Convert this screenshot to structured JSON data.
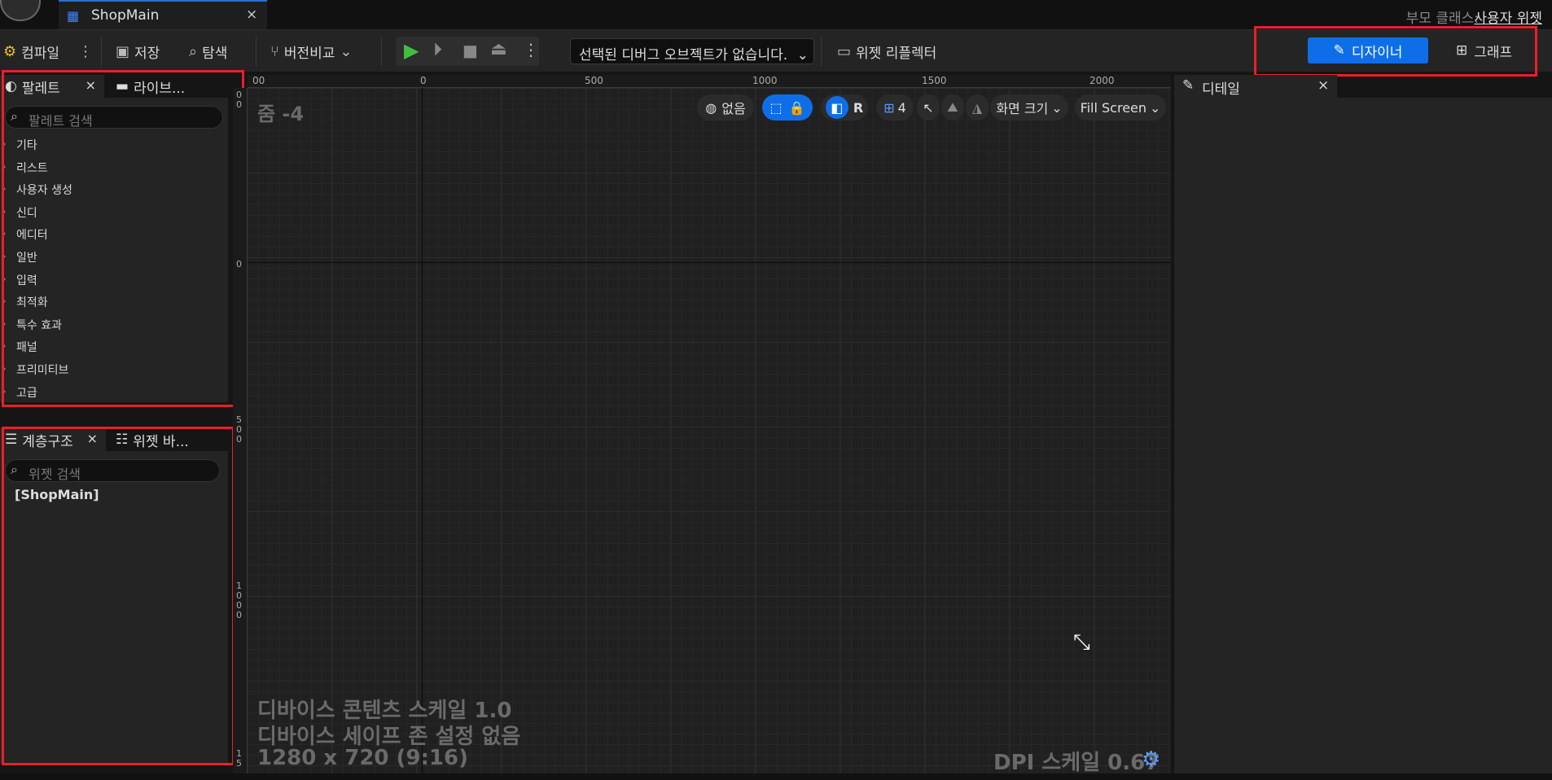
{
  "titlebar": {
    "document_tab": "ShopMain",
    "close_glyph": "×",
    "parent_class_label": "부모 클래스:",
    "parent_class_value": "사용자 위젯"
  },
  "toolbar": {
    "compile": "컴파일",
    "save": "저장",
    "browse": "탐색",
    "diff": "버전비교",
    "debug_object": "선택된 디버그 오브젝트가 없습니다.",
    "widget_reflector": "위젯 리플렉터",
    "designer": "디자이너",
    "graph": "그래프"
  },
  "palette": {
    "tab_label": "팔레트",
    "library_tab": "라이브...",
    "search_placeholder": "팔레트 검색",
    "categories": [
      "기타",
      "리스트",
      "사용자 생성",
      "신디",
      "에디터",
      "일반",
      "입력",
      "최적화",
      "특수 효과",
      "패널",
      "프리미티브",
      "고급"
    ]
  },
  "hierarchy": {
    "tab_label": "계층구조",
    "widget_binding_tab": "위젯 바...",
    "search_placeholder": "위젯 검색",
    "root_item": "[ShopMain]"
  },
  "viewport": {
    "zoom": "줌 -4",
    "ruler_top": [
      "00",
      "0",
      "500",
      "1000",
      "1500",
      "2000"
    ],
    "ruler_left": [
      "0",
      "0",
      "0",
      "5\n0\n0",
      "1\n0\n0\n0",
      "1\n5"
    ],
    "world_label": "없음",
    "rotate_label": "R",
    "grid_size": "4",
    "screen_size": "화면 크기",
    "fill_mode": "Fill Screen",
    "device_scale": "디바이스 콘텐츠 스케일 1.0",
    "safe_zone": "디바이스 세이프 존 설정 없음",
    "resolution": "1280 x 720 (9:16)",
    "dpi_scale": "DPI 스케일 0.67"
  },
  "details": {
    "tab_label": "디테일"
  },
  "colors": {
    "accent": "#0d6ee8",
    "highlight_box": "#e8202a"
  }
}
